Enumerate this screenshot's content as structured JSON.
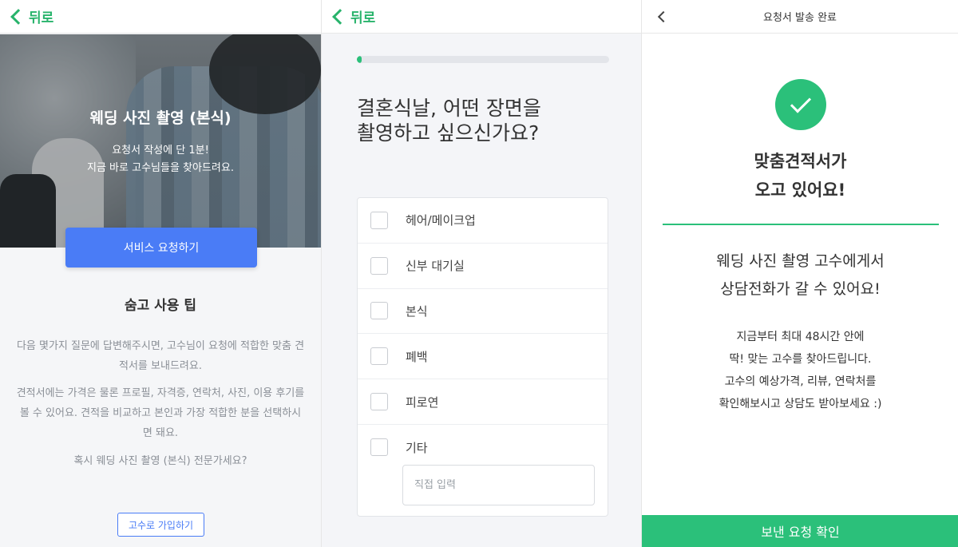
{
  "panel1": {
    "back_label": "뒤로",
    "hero_title": "웨딩 사진 촬영 (본식)",
    "hero_sub_1": "요청서 작성에 단 1분!",
    "hero_sub_2": "지금 바로 고수님들을 찾아드려요.",
    "request_button": "서비스 요청하기",
    "tips_title": "숨고 사용 팁",
    "tip_1": "다음 몇가지 질문에 답변해주시면, 고수님이 요청에 적합한 맞춤 견적서를 보내드려요.",
    "tip_2": "견적서에는 가격은 물론 프로필, 자격증, 연락처, 사진, 이용 후기를 볼 수 있어요. 견적을 비교하고 본인과 가장 적합한 분을 선택하시면 돼요.",
    "tip_3": "혹시 웨딩 사진 촬영 (본식) 전문가세요?",
    "pro_signup_button": "고수로 가입하기"
  },
  "panel2": {
    "back_label": "뒤로",
    "progress": 0.02,
    "question_line1": "결혼식날, 어떤 장면을",
    "question_line2": "촬영하고 싶으신가요?",
    "options": [
      "헤어/메이크업",
      "신부 대기실",
      "본식",
      "폐백",
      "피로연",
      "기타"
    ],
    "direct_input_placeholder": "직접 입력"
  },
  "panel3": {
    "title": "요청서 발송 완료",
    "headline_1": "맞춤견적서가",
    "headline_2": "오고 있어요!",
    "mid_1": "웨딩 사진 촬영 고수에게서",
    "mid_2": "상담전화가 갈 수 있어요!",
    "small_1": "지금부터 최대 48시간 안에",
    "small_2": "딱! 맞는 고수를 찾아드립니다.",
    "small_3": "고수의 예상가격, 리뷰, 연락처를",
    "small_4": "확인해보시고 상담도 받아보세요 :)",
    "confirm_button": "보낸 요청 확인"
  },
  "colors": {
    "accent_green": "#2bc07a",
    "accent_blue": "#4a7cf6"
  },
  "icons": [
    "chevron-left-icon",
    "checkbox-icon",
    "check-icon"
  ]
}
